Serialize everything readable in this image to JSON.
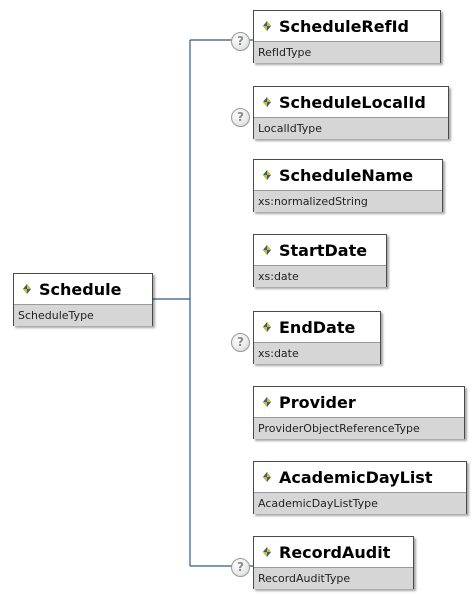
{
  "root": {
    "name": "Schedule",
    "type": "ScheduleType"
  },
  "help_glyph": "?",
  "children": [
    {
      "name": "ScheduleRefId",
      "type": "RefIdType",
      "optional": true
    },
    {
      "name": "ScheduleLocalId",
      "type": "LocalIdType",
      "optional": true
    },
    {
      "name": "ScheduleName",
      "type": "xs:normalizedString",
      "optional": false
    },
    {
      "name": "StartDate",
      "type": "xs:date",
      "optional": false
    },
    {
      "name": "EndDate",
      "type": "xs:date",
      "optional": true
    },
    {
      "name": "Provider",
      "type": "ProviderObjectReferenceType",
      "optional": false
    },
    {
      "name": "AcademicDayList",
      "type": "AcademicDayListType",
      "optional": false
    },
    {
      "name": "RecordAudit",
      "type": "RecordAuditType",
      "optional": true
    }
  ],
  "colors": {
    "line": "#2b5a88",
    "icon_blue": "#1f5fa8",
    "icon_yellow": "#f2b600",
    "type_bg": "#d6d6d6"
  }
}
